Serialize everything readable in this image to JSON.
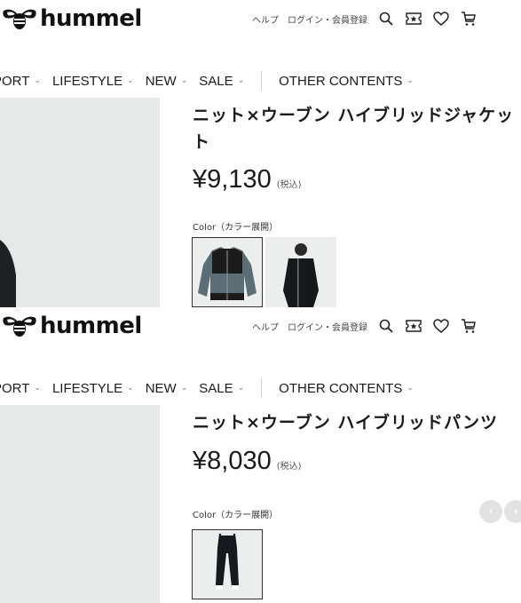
{
  "header": {
    "logo_text": "hummel",
    "help": "ヘルプ",
    "login": "ログイン・会員登録",
    "icons": [
      "search-icon",
      "coupon-icon",
      "heart-icon",
      "cart-icon"
    ]
  },
  "nav": {
    "items": [
      {
        "label": "PORT"
      },
      {
        "label": "LIFESTYLE"
      },
      {
        "label": "NEW"
      },
      {
        "label": "SALE"
      },
      {
        "label": "OTHER CONTENTS"
      }
    ]
  },
  "products": [
    {
      "title": "ニット×ウーブン ハイブリッドジャケット",
      "price": "¥9,130",
      "tax_note": "(税込)",
      "color_label": "Color（カラー展開）",
      "swatch_count": 2
    },
    {
      "title": "ニット×ウーブン ハイブリッドパンツ",
      "price": "¥8,030",
      "tax_note": "(税込)",
      "color_label": "Color（カラー展開）",
      "swatch_count": 1
    }
  ],
  "colors": {
    "text": "#1a1a1a",
    "hero_bg": "#e7e9e9",
    "swatch_border": "#333333",
    "arrow_bg": "#e2e2e2"
  }
}
